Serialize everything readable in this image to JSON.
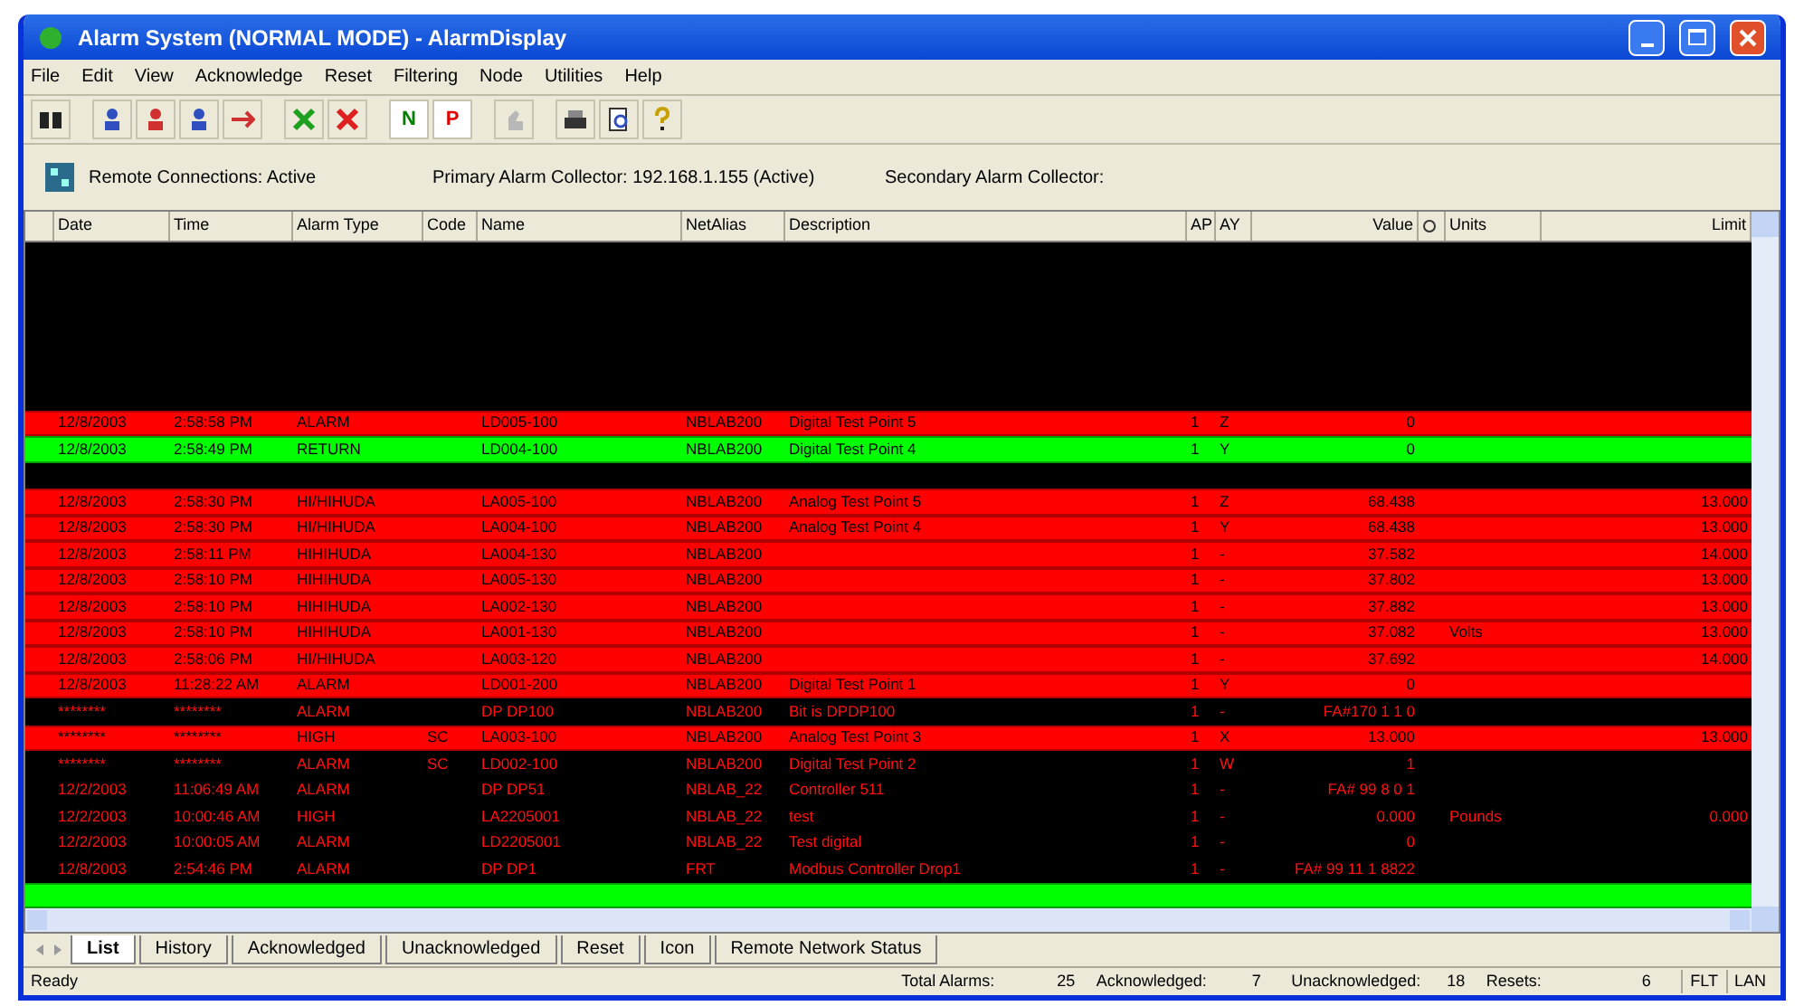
{
  "window": {
    "title": "Alarm System (NORMAL MODE) - AlarmDisplay"
  },
  "menu": [
    "File",
    "Edit",
    "View",
    "Acknowledge",
    "Reset",
    "Filtering",
    "Node",
    "Utilities",
    "Help"
  ],
  "toolbar": {
    "letters": [
      {
        "label": "N",
        "color": "#008000"
      },
      {
        "label": "P",
        "color": "#e00000"
      }
    ]
  },
  "info": [
    "Remote Connections: Active",
    "Primary Alarm Collector: 192.168.1.155 (Active)",
    "Secondary Alarm Collector:"
  ],
  "table": {
    "columns": [
      {
        "label": "Date",
        "kind": "text"
      },
      {
        "label": "Time",
        "kind": "text"
      },
      {
        "label": "Alarm Type",
        "kind": "text"
      },
      {
        "label": "Code",
        "kind": "text"
      },
      {
        "label": "Name",
        "kind": "text"
      },
      {
        "label": "NetAlias",
        "kind": "text"
      },
      {
        "label": "Description",
        "kind": "text"
      },
      {
        "label": "AP",
        "kind": "text"
      },
      {
        "label": "AY",
        "kind": "text"
      },
      {
        "label": "Value",
        "kind": "number"
      },
      {
        "kind": "icon"
      },
      {
        "label": "Units",
        "kind": "text"
      },
      {
        "label": "Limit",
        "kind": "number"
      }
    ],
    "rows": [
      {
        "kind": "alarm",
        "cells": [
          "12/8/2003",
          "2:58:58 PM",
          "ALARM",
          null,
          "LD005-100",
          "NBLAB200",
          "Digital Test Point 5",
          "1",
          "Z",
          "0",
          null,
          null,
          null
        ]
      },
      {
        "kind": "return",
        "cells": [
          "12/8/2003",
          "2:58:49 PM",
          "RETURN",
          null,
          "LD004-100",
          "NBLAB200",
          "Digital Test Point 4",
          "1",
          "Y",
          "0",
          null,
          null,
          null
        ]
      },
      {
        "kind": "gap"
      },
      {
        "kind": "alarm",
        "cells": [
          "12/8/2003",
          "2:58:30 PM",
          "HI/HIHUDA",
          null,
          "LA005-100",
          "NBLAB200",
          "Analog Test Point 5",
          "1",
          "Z",
          "68.438",
          null,
          null,
          "13.000"
        ]
      },
      {
        "kind": "alarm",
        "cells": [
          "12/8/2003",
          "2:58:30 PM",
          "HI/HIHUDA",
          null,
          "LA004-100",
          "NBLAB200",
          "Analog Test Point 4",
          "1",
          "Y",
          "68.438",
          null,
          null,
          "13.000"
        ]
      },
      {
        "kind": "alarm",
        "cells": [
          "12/8/2003",
          "2:58:11 PM",
          "HIHIHUDA",
          null,
          "LA004-130",
          "NBLAB200",
          null,
          "1",
          "-",
          "37.582",
          null,
          null,
          "14.000"
        ]
      },
      {
        "kind": "alarm",
        "cells": [
          "12/8/2003",
          "2:58:10 PM",
          "HIHIHUDA",
          null,
          "LA005-130",
          "NBLAB200",
          null,
          "1",
          "-",
          "37.802",
          null,
          null,
          "13.000"
        ]
      },
      {
        "kind": "alarm",
        "cells": [
          "12/8/2003",
          "2:58:10 PM",
          "HIHIHUDA",
          null,
          "LA002-130",
          "NBLAB200",
          null,
          "1",
          "-",
          "37.882",
          null,
          null,
          "13.000"
        ]
      },
      {
        "kind": "alarm",
        "cells": [
          "12/8/2003",
          "2:58:10 PM",
          "HIHIHUDA",
          null,
          "LA001-130",
          "NBLAB200",
          null,
          "1",
          "-",
          "37.082",
          null,
          "Volts",
          "13.000"
        ]
      },
      {
        "kind": "alarm",
        "cells": [
          "12/8/2003",
          "2:58:06 PM",
          "HI/HIHUDA",
          null,
          "LA003-120",
          "NBLAB200",
          null,
          "1",
          "-",
          "37.692",
          null,
          null,
          "14.000"
        ]
      },
      {
        "kind": "alarm",
        "cells": [
          "12/8/2003",
          "11:28:22 AM",
          "ALARM",
          null,
          "LD001-200",
          "NBLAB200",
          "Digital Test Point 1",
          "1",
          "Y",
          "0",
          null,
          null,
          null
        ]
      },
      {
        "kind": "history",
        "cells": [
          "********",
          "********",
          "ALARM",
          null,
          "DP DP100",
          "NBLAB200",
          "Bit is DPDP100",
          "1",
          "-",
          "FA#170 1 1 0",
          null,
          null,
          null
        ]
      },
      {
        "kind": "alarm",
        "cells": [
          "********",
          "********",
          "HIGH",
          "SC",
          "LA003-100",
          "NBLAB200",
          "Analog Test Point 3",
          "1",
          "X",
          "13.000",
          null,
          null,
          "13.000"
        ]
      },
      {
        "kind": "history",
        "cells": [
          "********",
          "********",
          "ALARM",
          "SC",
          "LD002-100",
          "NBLAB200",
          "Digital Test Point 2",
          "1",
          "W",
          "1",
          null,
          null,
          null
        ]
      },
      {
        "kind": "history",
        "cells": [
          "12/2/2003",
          "11:06:49 AM",
          "ALARM",
          null,
          "DP DP51",
          "NBLAB_22",
          "Controller 511",
          "1",
          "-",
          "FA# 99 8 0 1",
          null,
          null,
          null
        ]
      },
      {
        "kind": "history",
        "cells": [
          "12/2/2003",
          "10:00:46 AM",
          "HIGH",
          null,
          "LA2205001",
          "NBLAB_22",
          "test",
          "1",
          "-",
          "0.000",
          null,
          "Pounds",
          "0.000"
        ]
      },
      {
        "kind": "history",
        "cells": [
          "12/2/2003",
          "10:00:05 AM",
          "ALARM",
          null,
          "LD2205001",
          "NBLAB_22",
          "Test digital",
          "1",
          "-",
          "0",
          null,
          null,
          null
        ]
      },
      {
        "kind": "history",
        "cells": [
          "12/8/2003",
          "2:54:46 PM",
          "ALARM",
          null,
          "DP DP1",
          "FRT",
          "Modbus Controller Drop1",
          "1",
          "-",
          "FA# 99 11 1 8822",
          null,
          null,
          null
        ]
      },
      {
        "kind": "return"
      }
    ]
  },
  "tabs": [
    {
      "label": "List",
      "selected": true
    },
    {
      "label": "History",
      "selected": false
    },
    {
      "label": "Acknowledged",
      "selected": false
    },
    {
      "label": "Unacknowledged",
      "selected": false
    },
    {
      "label": "Reset",
      "selected": false
    },
    {
      "label": "Icon",
      "selected": false
    },
    {
      "label": "Remote Network Status",
      "selected": false
    }
  ],
  "status_bar": {
    "message": "Ready",
    "counts": [
      {
        "label": "Total Alarms:",
        "value": "25"
      },
      {
        "label": "Acknowledged:",
        "value": "7"
      },
      {
        "label": "Unacknowledged:",
        "value": "18"
      },
      {
        "label": "Resets:",
        "value": "6"
      }
    ],
    "indicators": [
      "FLT",
      "LAN"
    ]
  }
}
